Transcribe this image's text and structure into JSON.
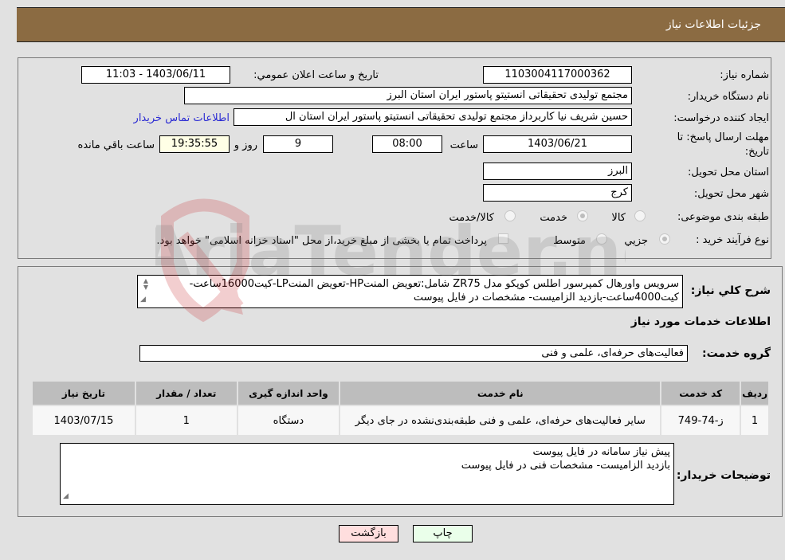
{
  "header": {
    "title": "جزئیات اطلاعات نیاز"
  },
  "info": {
    "need_number_label": "شماره نیاز:",
    "need_number": "1103004117000362",
    "announce_label": "تاریخ و ساعت اعلان عمومي:",
    "announce_value": "1403/06/11 - 11:03",
    "buyer_org_label": "نام دستگاه خریدار:",
    "buyer_org": "مجتمع تولیدی تحقیقاتی انستیتو پاستور ایران استان البرز",
    "creator_label": "ایجاد کننده درخواست:",
    "creator": "حسین شریف نیا کاربرداز مجتمع تولیدی تحقیقاتی انستیتو پاستور ایران استان ال",
    "contact_link": "اطلاعات تماس خریدار",
    "deadline_label_1": "مهلت ارسال پاسخ: تا",
    "deadline_label_2": "تاریخ:",
    "deadline_date": "1403/06/21",
    "time_label": "ساعت",
    "deadline_time": "08:00",
    "days": "9",
    "days_label": "روز و",
    "remaining": "19:35:55",
    "remaining_label": "ساعت باقي مانده",
    "province_label": "استان محل تحویل:",
    "province": "البرز",
    "city_label": "شهر محل تحویل:",
    "city": "کرج",
    "category_label": "طبقه بندی موضوعی:",
    "category_options": [
      {
        "label": "کالا",
        "selected": false
      },
      {
        "label": "خدمت",
        "selected": true
      },
      {
        "label": "کالا/خدمت",
        "selected": false
      }
    ],
    "process_label": "نوع فرآیند خرید :",
    "process_options": [
      {
        "label": "جزيي",
        "selected": true
      },
      {
        "label": "متوسط",
        "selected": false
      }
    ],
    "treasury_note": "پرداخت تمام یا بخشی از مبلغ خرید،از محل \"اسناد خزانه اسلامی\" خواهد بود."
  },
  "details": {
    "description_label": "شرح كلي نياز:",
    "description": "سرویس واورهال کمپرسور اطلس کوپکو مدل ZR75 شامل:تعویض المنتHP-تعویض المنتLP-کیت16000ساعت-کیت4000ساعت-بازدید الزامیست- مشخصات در فایل پیوست",
    "services_title": "اطلاعات خدمات مورد نیاز",
    "service_group_label": "گروه خدمت:",
    "service_group": "فعالیت‌های حرفه‌ای، علمی و فنی",
    "table": {
      "headers": [
        "ردیف",
        "کد خدمت",
        "نام خدمت",
        "واحد اندازه گیری",
        "تعداد / مقدار",
        "تاریخ نیاز"
      ],
      "rows": [
        [
          "1",
          "ز-74-749",
          "سایر فعالیت‌های حرفه‌ای، علمی و فنی طبقه‌بندی‌نشده در جای دیگر",
          "دستگاه",
          "1",
          "1403/07/15"
        ]
      ]
    },
    "buyer_notes_label": "توضیحات خریدار:",
    "buyer_notes_line1": "پیش نیاز سامانه در فایل پیوست",
    "buyer_notes_line2": "بازدید الزامیست- مشخصات فنی در فایل پیوست"
  },
  "buttons": {
    "print": "چاپ",
    "back": "بازگشت"
  },
  "watermark": {
    "text": "AriaTender.neT"
  }
}
